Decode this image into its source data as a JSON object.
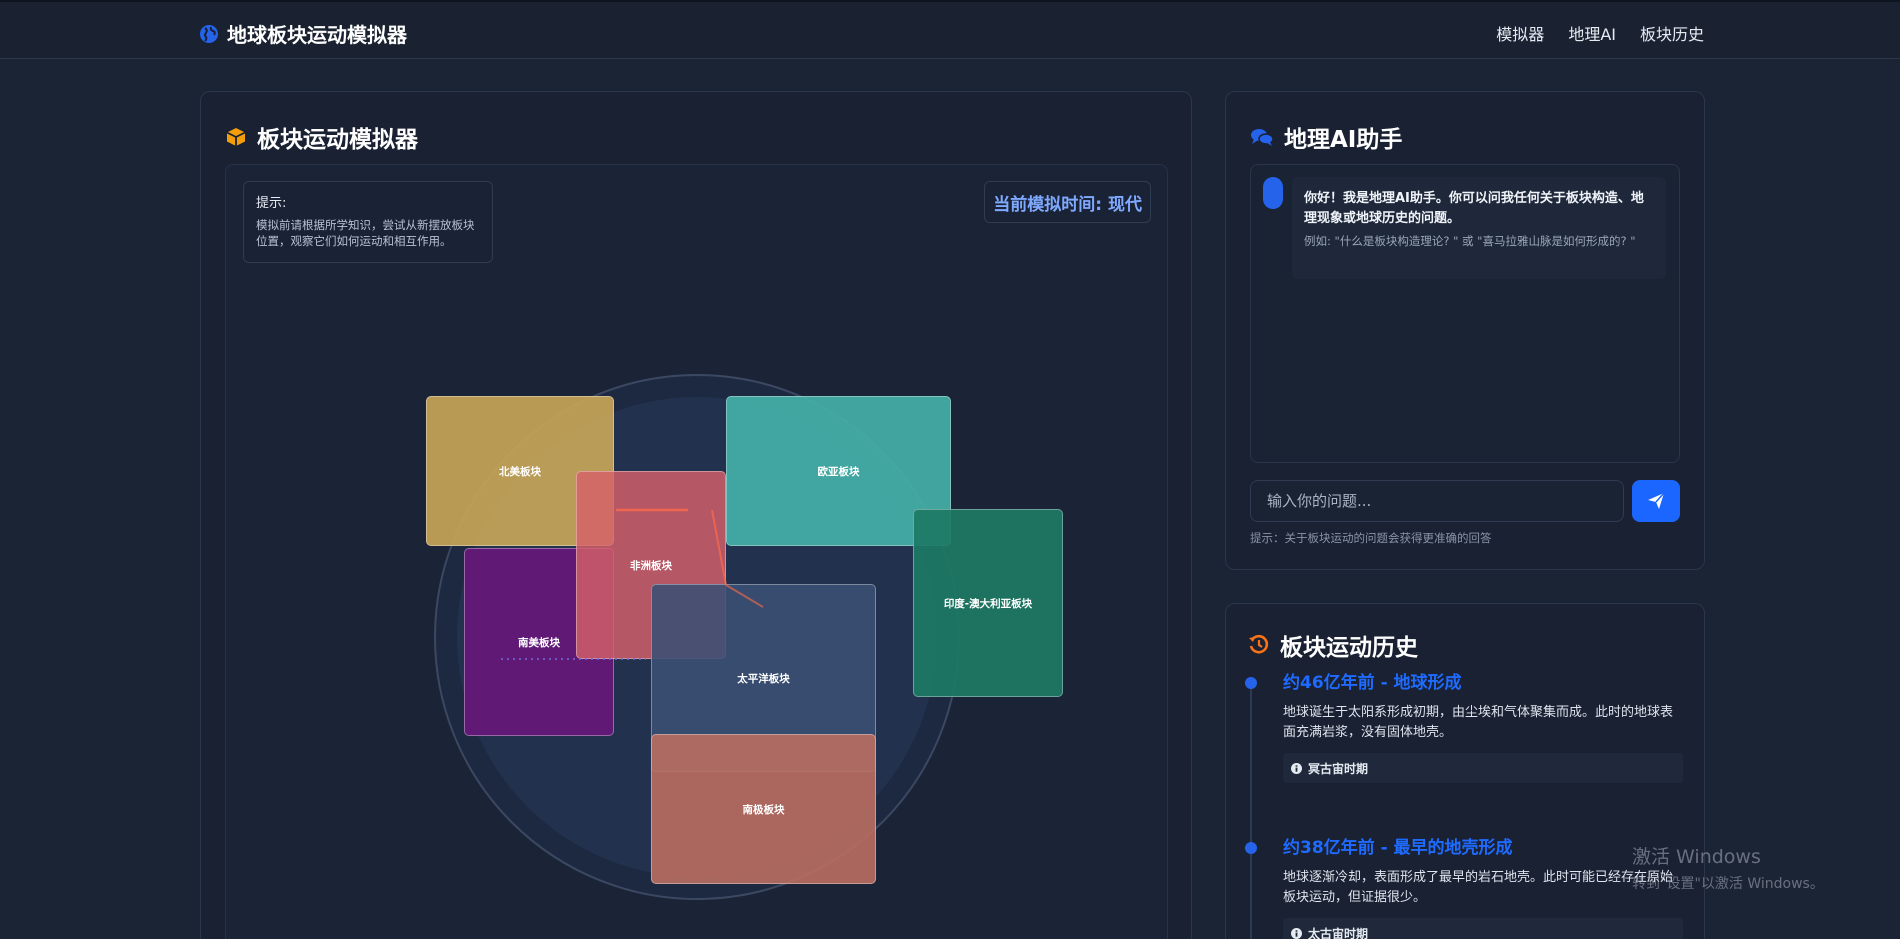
{
  "header": {
    "brand_icon": "globe-icon",
    "brand_title": "地球板块运动模拟器",
    "nav": [
      "模拟器",
      "地理AI",
      "板块历史"
    ]
  },
  "simulator": {
    "icon": "cube-icon",
    "title": "板块运动模拟器",
    "hint_title": "提示:",
    "hint_text": "模拟前请根据所学知识，尝试从新摆放板块位置，观察它们如何运动和相互作用。",
    "time_label": "当前模拟时间: 现代",
    "plates": [
      "北美板块",
      "欧亚板块",
      "非洲板块",
      "印度-澳大利亚板块",
      "南美板块",
      "太平洋板块",
      "南极板块"
    ]
  },
  "ai": {
    "icon": "chat-bubbles-icon",
    "title": "地理AI助手",
    "bot_message": "你好！我是地理AI助手。你可以问我任何关于板块构造、地理现象或地球历史的问题。",
    "bot_example": "例如: \"什么是板块构造理论? \" 或 \"喜马拉雅山脉是如何形成的? \"",
    "input_placeholder": "输入你的问题...",
    "send_icon": "paper-plane-icon",
    "hint": "提示：关于板块运动的问题会获得更准确的回答"
  },
  "history": {
    "icon": "history-icon",
    "title": "板块运动历史",
    "events": [
      {
        "title": "约46亿年前 - 地球形成",
        "desc": "地球诞生于太阳系形成初期，由尘埃和气体聚集而成。此时的地球表面充满岩浆，没有固体地壳。",
        "era": "冥古宙时期"
      },
      {
        "title": "约38亿年前 - 最早的地壳形成",
        "desc": "地球逐渐冷却，表面形成了最早的岩石地壳。此时可能已经存在原始板块运动，但证据很少。",
        "era": "太古宙时期"
      }
    ]
  },
  "watermark": {
    "line1": "激活 Windows",
    "line2": "转到\"设置\"以激活 Windows。"
  },
  "colors": {
    "accent": "#1a66ff",
    "history_title": "#1f6bff",
    "time_label": "#7fa8ff",
    "cube_icon": "#f59e0b",
    "history_icon": "#f97316"
  }
}
